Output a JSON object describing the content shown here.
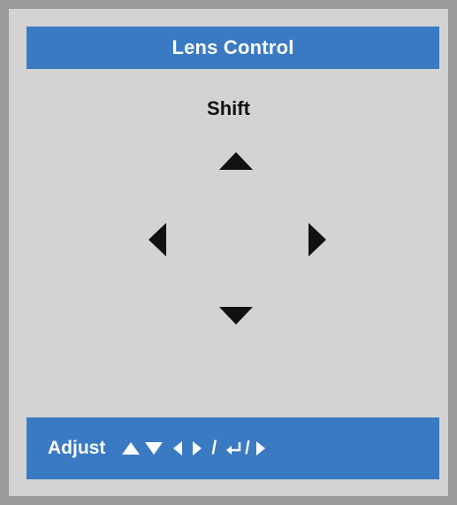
{
  "menu": {
    "title": "Lens Control",
    "section_label": "Shift"
  },
  "arrows": {
    "up": "arrow-up-icon",
    "down": "arrow-down-icon",
    "left": "arrow-left-icon",
    "right": "arrow-right-icon"
  },
  "hint": {
    "label": "Adjust",
    "separator": "/",
    "icons": [
      "triangle-up-icon",
      "triangle-down-icon",
      "triangle-left-icon",
      "triangle-right-icon",
      "enter-icon",
      "triangle-right-icon"
    ]
  },
  "colors": {
    "bar": "#3a7ac3",
    "panel": "#d3d3d3",
    "frame": "#9b9b9b",
    "text": "#111111"
  }
}
